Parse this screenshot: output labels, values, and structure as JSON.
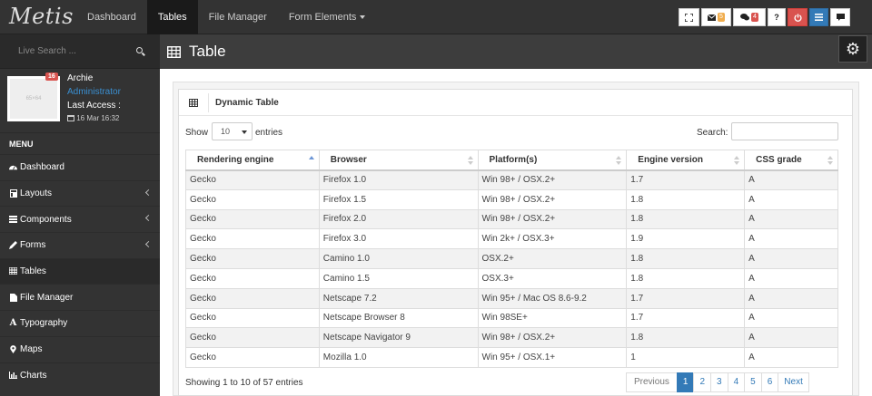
{
  "app": {
    "brand": "Metis"
  },
  "topnav": [
    {
      "label": "Dashboard",
      "active": false
    },
    {
      "label": "Tables",
      "active": true
    },
    {
      "label": "File Manager",
      "active": false
    },
    {
      "label": "Form Elements",
      "active": false,
      "dropdown": true
    }
  ],
  "toolbar": {
    "fullscreen_icon": "expand-icon",
    "mail_icon": "envelope-icon",
    "mail_count": "5",
    "mail_color": "#f0ad4e",
    "chat_icon": "comments-icon",
    "chat_count": "4",
    "chat_color": "#d9534f",
    "help_label": "?",
    "power_icon": "power-icon",
    "menu_icon": "bars-icon",
    "comment_icon": "comment-icon"
  },
  "sidebar": {
    "search_placeholder": "Live Search ...",
    "user": {
      "name": "Archie",
      "role": "Administrator",
      "last_access_label": "Last Access :",
      "last_access_date": "16 Mar 16:32",
      "notification_count": "16",
      "avatar_text": "65×64"
    },
    "menu_title": "MENU",
    "items": [
      {
        "label": "Dashboard",
        "icon": "dashboard-icon",
        "chevron": false,
        "active": false
      },
      {
        "label": "Layouts",
        "icon": "layouts-icon",
        "chevron": true,
        "active": false
      },
      {
        "label": "Components",
        "icon": "components-icon",
        "chevron": true,
        "active": false
      },
      {
        "label": "Forms",
        "icon": "pencil-icon",
        "chevron": true,
        "active": false
      },
      {
        "label": "Tables",
        "icon": "table-icon",
        "chevron": false,
        "active": true
      },
      {
        "label": "File Manager",
        "icon": "file-icon",
        "chevron": false,
        "active": false
      },
      {
        "label": "Typography",
        "icon": "font-icon",
        "chevron": false,
        "active": false
      },
      {
        "label": "Maps",
        "icon": "map-marker-icon",
        "chevron": false,
        "active": false
      },
      {
        "label": "Charts",
        "icon": "bar-chart-icon",
        "chevron": false,
        "active": false
      }
    ]
  },
  "header": {
    "title": "Table",
    "icon": "table-icon",
    "settings_icon": "gears-icon"
  },
  "panel": {
    "title": "Dynamic Table"
  },
  "controls": {
    "show_label": "Show",
    "page_size": "10",
    "entries_label": "entries",
    "search_label": "Search:"
  },
  "table": {
    "columns": [
      "Rendering engine",
      "Browser",
      "Platform(s)",
      "Engine version",
      "CSS grade"
    ],
    "sorted_column": 0,
    "rows": [
      [
        "Gecko",
        "Firefox 1.0",
        "Win 98+ / OSX.2+",
        "1.7",
        "A"
      ],
      [
        "Gecko",
        "Firefox 1.5",
        "Win 98+ / OSX.2+",
        "1.8",
        "A"
      ],
      [
        "Gecko",
        "Firefox 2.0",
        "Win 98+ / OSX.2+",
        "1.8",
        "A"
      ],
      [
        "Gecko",
        "Firefox 3.0",
        "Win 2k+ / OSX.3+",
        "1.9",
        "A"
      ],
      [
        "Gecko",
        "Camino 1.0",
        "OSX.2+",
        "1.8",
        "A"
      ],
      [
        "Gecko",
        "Camino 1.5",
        "OSX.3+",
        "1.8",
        "A"
      ],
      [
        "Gecko",
        "Netscape 7.2",
        "Win 95+ / Mac OS 8.6-9.2",
        "1.7",
        "A"
      ],
      [
        "Gecko",
        "Netscape Browser 8",
        "Win 98SE+",
        "1.7",
        "A"
      ],
      [
        "Gecko",
        "Netscape Navigator 9",
        "Win 98+ / OSX.2+",
        "1.8",
        "A"
      ],
      [
        "Gecko",
        "Mozilla 1.0",
        "Win 95+ / OSX.1+",
        "1",
        "A"
      ]
    ]
  },
  "footer": {
    "info": "Showing 1 to 10 of 57 entries",
    "pagination": {
      "previous": "Previous",
      "pages": [
        "1",
        "2",
        "3",
        "4",
        "5",
        "6"
      ],
      "current": "1",
      "next": "Next"
    }
  }
}
